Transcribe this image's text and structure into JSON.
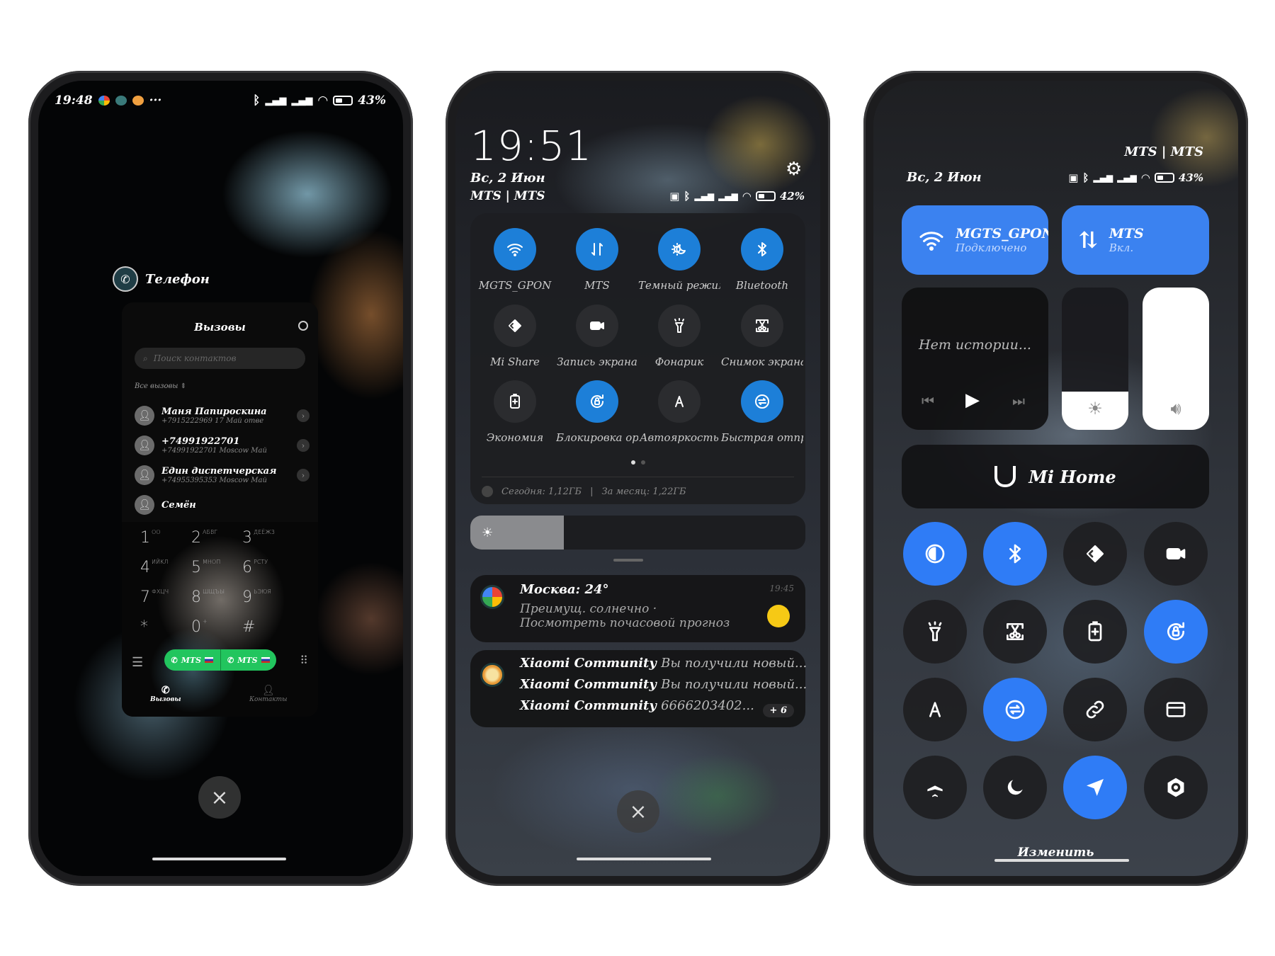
{
  "colors": {
    "accent_blue": "#1d7fd8",
    "cc_blue": "#2f7cf6",
    "call_green": "#22c55e"
  },
  "phone1": {
    "status": {
      "time": "19:48",
      "more": "···",
      "battery": "43%",
      "battery_level": 0.43,
      "app_icons": [
        "google-icon",
        "cleaner-icon",
        "community-icon"
      ]
    },
    "app_title": "Телефон",
    "card": {
      "title": "Вызовы",
      "search_placeholder": "Поиск контактов",
      "filter": "Все вызовы",
      "calls": [
        {
          "name": "Маня Папироскина",
          "sub": "+7915222969 17 Май  отве"
        },
        {
          "name": "+74991922701",
          "sub": "+74991922701 Moscow  Май"
        },
        {
          "name": "Един диспетчерская",
          "sub": "+74955395353 Moscow  Май"
        },
        {
          "name": "Семён",
          "sub": ""
        }
      ],
      "keys": [
        {
          "d": "1",
          "l": "OO"
        },
        {
          "d": "2",
          "l": "АБВГ"
        },
        {
          "d": "3",
          "l": "ДЕЁЖЗ"
        },
        {
          "d": "4",
          "l": "ИЙКЛ"
        },
        {
          "d": "5",
          "l": "МНОП"
        },
        {
          "d": "6",
          "l": "РСТУ"
        },
        {
          "d": "7",
          "l": "ФХЦЧ"
        },
        {
          "d": "8",
          "l": "ШЩЪЫ"
        },
        {
          "d": "9",
          "l": "ЬЭЮЯ"
        },
        {
          "d": "*",
          "l": ""
        },
        {
          "d": "0",
          "l": "+"
        },
        {
          "d": "#",
          "l": ""
        }
      ],
      "sim1": "MTS",
      "sim2": "MTS",
      "tab_calls": "Вызовы",
      "tab_contacts": "Контакты"
    }
  },
  "phone2": {
    "time": "19:51",
    "date": "Вс, 2 Июн",
    "carriers": "MTS | MTS",
    "battery": "42%",
    "battery_level": 0.42,
    "tiles": [
      {
        "label": "MGTS_GPON",
        "icon": "wifi-icon",
        "on": true
      },
      {
        "label": "MTS",
        "icon": "mobile-data-icon",
        "on": true
      },
      {
        "label": "Темный режим",
        "icon": "dark-mode-icon",
        "on": true
      },
      {
        "label": "Bluetooth",
        "icon": "bluetooth-icon",
        "on": true
      },
      {
        "label": "Mi Share",
        "icon": "mi-share-icon",
        "on": false
      },
      {
        "label": "Запись экрана",
        "icon": "screen-record-icon",
        "on": false
      },
      {
        "label": "Фонарик",
        "icon": "flashlight-icon",
        "on": false
      },
      {
        "label": "Снимок экрана",
        "icon": "screenshot-icon",
        "on": false
      },
      {
        "label": "Экономия",
        "icon": "battery-saver-icon",
        "on": false
      },
      {
        "label": "Блокировка ориентации",
        "icon": "rotation-lock-icon",
        "on": true
      },
      {
        "label": "Автояркость",
        "icon": "auto-brightness-icon",
        "on": false
      },
      {
        "label": "Быстрая отправка",
        "icon": "quick-send-icon",
        "on": true
      }
    ],
    "data_today": "Сегодня: 1,12ГБ",
    "data_month": "За месяц: 1,22ГБ",
    "brightness": 0.28,
    "notifications": [
      {
        "title": "Москва: 24°",
        "time": "19:45",
        "body": "Преимущ. солнечно · Посмотреть почасовой прогноз"
      },
      {
        "lines": [
          {
            "app": "Xiaomi Community",
            "text": "Вы получили новый..."
          },
          {
            "app": "Xiaomi Community",
            "text": "Вы получили новый..."
          },
          {
            "app": "Xiaomi Community",
            "text": "6666203402..."
          }
        ],
        "more": "+ 6"
      }
    ]
  },
  "phone3": {
    "carriers": "MTS | MTS",
    "date": "Вс, 2 Июн",
    "battery": "43%",
    "battery_level": 0.43,
    "wifi": {
      "name": "MGTS_GPON",
      "status": "Подключено"
    },
    "mobile": {
      "name": "MTS",
      "status": "Вкл."
    },
    "media_text": "Нет истории...",
    "brightness": 0.27,
    "volume": 1.0,
    "mi_home": "Mi Home",
    "grid": [
      {
        "icon": "vision-icon",
        "on": true
      },
      {
        "icon": "bluetooth-icon",
        "on": true
      },
      {
        "icon": "mi-share-icon",
        "on": false
      },
      {
        "icon": "screen-record-icon",
        "on": false
      },
      {
        "icon": "flashlight-icon",
        "on": false
      },
      {
        "icon": "screenshot-icon",
        "on": false
      },
      {
        "icon": "battery-saver-icon",
        "on": false
      },
      {
        "icon": "rotation-lock-icon",
        "on": true
      },
      {
        "icon": "auto-brightness-icon",
        "on": false
      },
      {
        "icon": "quick-send-icon",
        "on": true
      },
      {
        "icon": "link-icon",
        "on": false
      },
      {
        "icon": "card-icon",
        "on": false
      },
      {
        "icon": "airplane-icon",
        "on": false
      },
      {
        "icon": "moon-icon",
        "on": false
      },
      {
        "icon": "location-icon",
        "on": true
      },
      {
        "icon": "camera-settings-icon",
        "on": false
      }
    ],
    "edit": "Изменить"
  }
}
